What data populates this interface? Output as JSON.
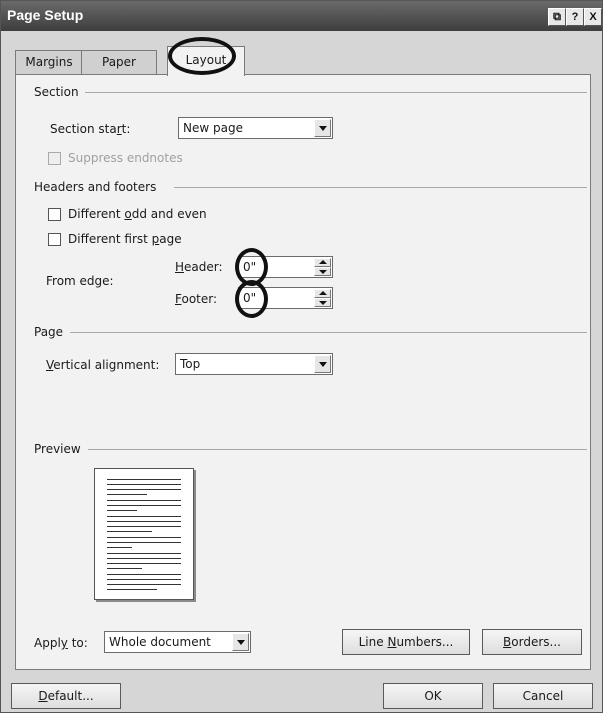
{
  "window": {
    "title": "Page Setup",
    "buttons": {
      "restore": "⧉",
      "help": "?",
      "close": "X"
    }
  },
  "tabs": [
    {
      "label": "Margins"
    },
    {
      "label": "Paper"
    },
    {
      "label": "Layout"
    }
  ],
  "section": {
    "group_label": "Section",
    "start_label_pre": "Section sta",
    "start_label_key": "r",
    "start_label_post": "t:",
    "start_value": "New page",
    "suppress_endnotes": "Suppress endnotes"
  },
  "headers_footers": {
    "group_label": "Headers and footers",
    "odd_even_pre": "Different ",
    "odd_even_key": "o",
    "odd_even_post": "dd and even",
    "first_page_pre": "Different first ",
    "first_page_key": "p",
    "first_page_post": "age",
    "from_edge": "From edge:",
    "header_key": "H",
    "header_post": "eader:",
    "header_value": "0\"",
    "footer_key": "F",
    "footer_post": "ooter:",
    "footer_value": "0\""
  },
  "page": {
    "group_label": "Page",
    "valign_key": "V",
    "valign_post": "ertical alignment:",
    "valign_value": "Top"
  },
  "preview": {
    "group_label": "Preview"
  },
  "apply": {
    "label_pre": "Appl",
    "label_key": "y",
    "label_post": " to:",
    "value": "Whole document",
    "line_numbers_pre": "Line ",
    "line_numbers_key": "N",
    "line_numbers_post": "umbers...",
    "borders_key": "B",
    "borders_post": "orders..."
  },
  "footer": {
    "default_key": "D",
    "default_post": "efault...",
    "ok": "OK",
    "cancel": "Cancel"
  }
}
